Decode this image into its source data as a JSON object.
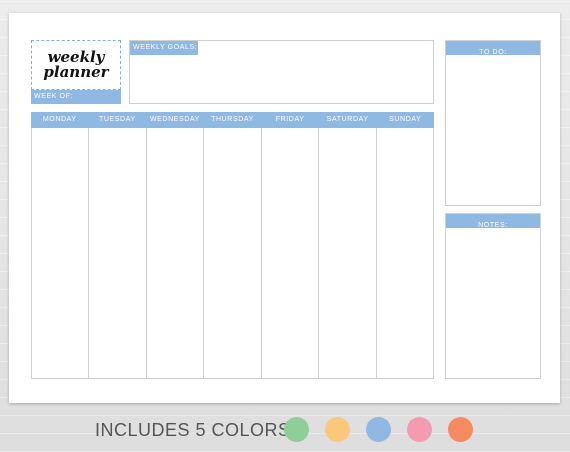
{
  "planner": {
    "logo_line1": "weekly",
    "logo_line2": "planner",
    "week_of_label": "WEEK OF:",
    "weekly_goals_label": "WEEKLY GOALS:",
    "todo_label": "TO DO:",
    "notes_label": "NOTES:",
    "days": [
      "MONDAY",
      "TUESDAY",
      "WEDNESDAY",
      "THURSDAY",
      "FRIDAY",
      "SATURDAY",
      "SUNDAY"
    ],
    "accent_color": "#8fb8e3"
  },
  "footer": {
    "text": "INCLUDES 5 COLORS:",
    "colors": [
      {
        "name": "green",
        "hex": "#8fce96"
      },
      {
        "name": "yellow",
        "hex": "#fbc77a"
      },
      {
        "name": "blue",
        "hex": "#8fb8e3"
      },
      {
        "name": "pink",
        "hex": "#f59bb0"
      },
      {
        "name": "orange",
        "hex": "#f78a60"
      }
    ]
  }
}
